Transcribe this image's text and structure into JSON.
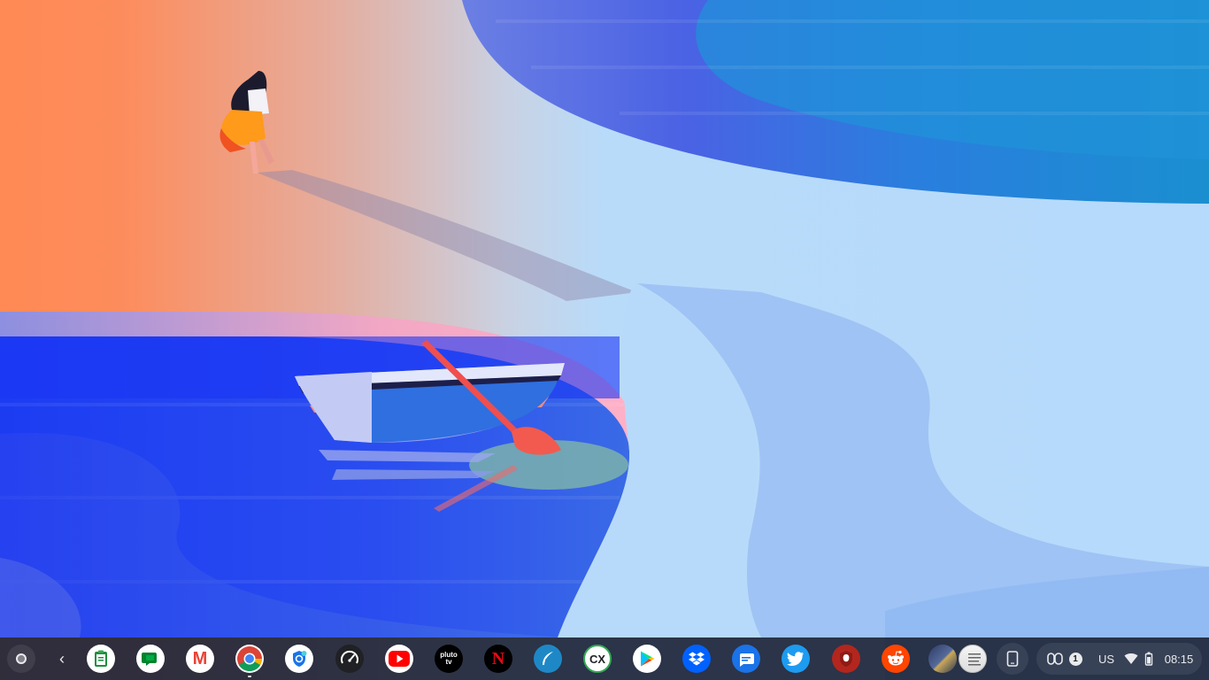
{
  "shelf": {
    "launcher": {
      "icon": "launcher-circle-icon"
    },
    "back": {
      "label": "‹",
      "icon": "chevron-left-icon"
    },
    "apps": [
      {
        "id": "clipboard",
        "icon": "clipboard-icon",
        "glyph": "",
        "bg": "#ffffff",
        "fg": "#1e8e3e"
      },
      {
        "id": "google-chat",
        "icon": "chat-icon",
        "glyph": "",
        "bg": "#ffffff",
        "fg": "#1ea446"
      },
      {
        "id": "gmail",
        "icon": "gmail-icon",
        "glyph": "M",
        "bg": "#ffffff",
        "fg": "#ea4335"
      },
      {
        "id": "chrome",
        "icon": "chrome-icon",
        "glyph": "",
        "bg": "#ffffff",
        "fg": "#4285f4",
        "running": true
      },
      {
        "id": "vpn",
        "icon": "vpn-shield-icon",
        "glyph": "",
        "bg": "#ffffff",
        "fg": "#1a73e8"
      },
      {
        "id": "speedometer",
        "icon": "speedometer-icon",
        "glyph": "",
        "bg": "#202124",
        "fg": "#ffffff"
      },
      {
        "id": "youtube",
        "icon": "youtube-icon",
        "glyph": "▶",
        "bg": "#ffffff",
        "fg": "#ffffff"
      },
      {
        "id": "pluto-tv",
        "icon": "pluto-tv-icon",
        "glyph": "pluto tv",
        "bg": "#000000",
        "fg": "#ffffff"
      },
      {
        "id": "netflix",
        "icon": "netflix-icon",
        "glyph": "N",
        "bg": "#000000",
        "fg": "#e50914"
      },
      {
        "id": "feather-app",
        "icon": "feather-icon",
        "glyph": "",
        "bg": "#1e88c7",
        "fg": "#ffffff"
      },
      {
        "id": "cx",
        "icon": "cx-icon",
        "glyph": "CX",
        "bg": "#ffffff",
        "fg": "#202124"
      },
      {
        "id": "play-store",
        "icon": "play-store-icon",
        "glyph": "",
        "bg": "#ffffff",
        "fg": "#34a853"
      },
      {
        "id": "dropbox",
        "icon": "dropbox-icon",
        "glyph": "",
        "bg": "#0061fe",
        "fg": "#ffffff"
      },
      {
        "id": "messages",
        "icon": "messages-icon",
        "glyph": "",
        "bg": "#1a73e8",
        "fg": "#ffffff"
      },
      {
        "id": "twitter",
        "icon": "twitter-icon",
        "glyph": "",
        "bg": "#1d9bf0",
        "fg": "#ffffff"
      },
      {
        "id": "shield-app",
        "icon": "red-shield-icon",
        "glyph": "",
        "bg": "#b3261e",
        "fg": "#ffffff"
      },
      {
        "id": "reddit",
        "icon": "reddit-icon",
        "glyph": "",
        "bg": "#ff4500",
        "fg": "#ffffff"
      }
    ],
    "pod": {
      "icon": "app-window-thumbnails-icon"
    },
    "phone_hub": {
      "icon": "phone-icon"
    },
    "status": {
      "cast_icon": "screen-cast-icon",
      "notification_count": "1",
      "ime": "US",
      "wifi_icon": "wifi-icon",
      "battery_icon": "battery-icon",
      "time": "08:15"
    }
  },
  "colors": {
    "shelf_bg": "#1e263a",
    "orange_sand": "#fe8c5a",
    "light_sand": "#b8dcfb",
    "deep_water": "#1f3ff0"
  }
}
